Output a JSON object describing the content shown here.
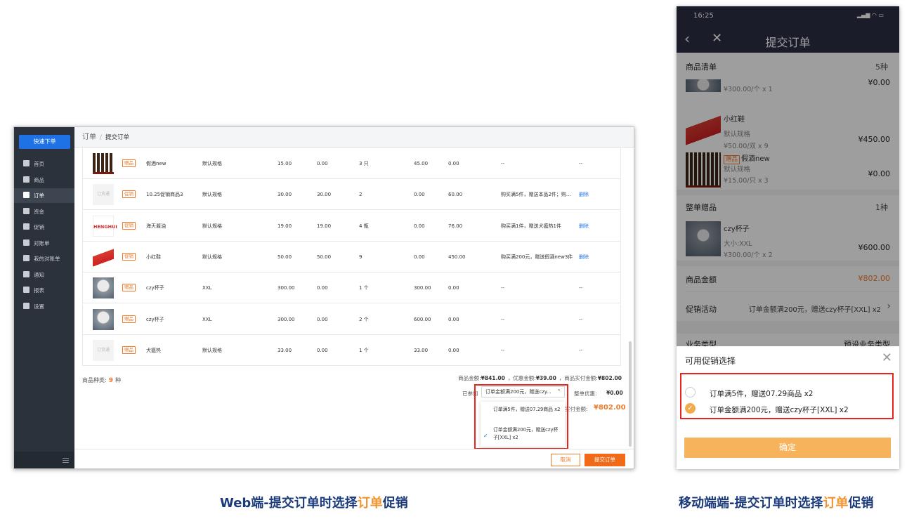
{
  "web": {
    "quick_order": "快速下单",
    "nav": [
      "首页",
      "商品",
      "订单",
      "资金",
      "促销",
      "对账单",
      "我的对账单",
      "通知",
      "报表",
      "设置"
    ],
    "nav_icons": [
      "home-icon",
      "goods-icon",
      "order-icon",
      "funds-icon",
      "promotion-icon",
      "statement-icon",
      "my-statement-icon",
      "bell-icon",
      "report-icon",
      "gear-icon"
    ],
    "active_nav": 2,
    "breadcrumb": {
      "parent": "订单",
      "current": "提交订单"
    },
    "rows": [
      {
        "img": "wine",
        "tag": "赠品",
        "name": "假酒new",
        "spec": "默认规格",
        "price": "15.00",
        "price2": "0.00",
        "qty": "3 只",
        "amount": "45.00",
        "paid": "0.00",
        "promo": "--",
        "action": "--"
      },
      {
        "img": "placeholder",
        "tag": "促销",
        "name": "10.25促销商品3",
        "spec": "默认规格",
        "price": "30.00",
        "price2": "30.00",
        "qty": "2",
        "amount": "0.00",
        "paid": "60.00",
        "promo": "购买满5件，赠送本品2件；购...",
        "action": "删除"
      },
      {
        "img": "brand",
        "tag": "促销",
        "name": "海天酱油",
        "spec": "默认规格",
        "price": "19.00",
        "price2": "19.00",
        "qty": "4 瓶",
        "amount": "0.00",
        "paid": "76.00",
        "promo": "购买满1件，赠送犬瘟热1件",
        "action": "删除"
      },
      {
        "img": "shoe",
        "tag": "促销",
        "name": "小红鞋",
        "spec": "默认规格",
        "price": "50.00",
        "price2": "50.00",
        "qty": "9",
        "amount": "0.00",
        "paid": "450.00",
        "promo": "购买满200元，赠送假酒new3件",
        "action": "删除"
      },
      {
        "img": "seal",
        "tag": "赠品",
        "name": "czy杯子",
        "spec": "XXL",
        "price": "300.00",
        "price2": "0.00",
        "qty": "1 个",
        "amount": "300.00",
        "paid": "0.00",
        "promo": "--",
        "action": "--"
      },
      {
        "img": "seal",
        "tag": "赠品",
        "name": "czy杯子",
        "spec": "XXL",
        "price": "300.00",
        "price2": "0.00",
        "qty": "2 个",
        "amount": "600.00",
        "paid": "0.00",
        "promo": "--",
        "action": "--"
      },
      {
        "img": "placeholder",
        "tag": "赠品",
        "name": "犬瘟热",
        "spec": "默认规格",
        "price": "33.00",
        "price2": "0.00",
        "qty": "1 个",
        "amount": "33.00",
        "paid": "0.00",
        "promo": "--",
        "action": "--"
      }
    ],
    "placeholder_img_text": "订货通",
    "brand_img_text": "HENGHUI",
    "summary": {
      "kinds_label": "商品种类:",
      "kinds_value": "9",
      "kinds_unit": "种",
      "goods_amount_label": "商品金额:",
      "goods_amount": "¥841.00",
      "discount_label": "，优惠金额:",
      "discount": "¥39.00",
      "paid_label": "，商品实付金额:",
      "paid": "¥802.00",
      "joined_label": "已参加",
      "selected_promo": "订单金额满200元，赠送czy...",
      "order_discount_label": "整单优惠:",
      "order_discount": "¥0.00",
      "total_label": "实付金额:",
      "total": "¥802.00"
    },
    "dropdown": [
      "订单满5件，赠送07.29商品 x2",
      "订单金额满200元，赠送czy杯子[XXL] x2"
    ],
    "dropdown_selected": 1,
    "cancel": "取消",
    "submit": "提交订单"
  },
  "mobile": {
    "time": "16:25",
    "status_icons": "signal wifi 67",
    "title": "提交订单",
    "goods_list_label": "商品清单",
    "goods_list_count": "5种",
    "item1_sub": "¥300.00/个 x 1",
    "item1_price": "¥0.00",
    "item2_name": "小红鞋",
    "item2_spec": "默认规格",
    "item2_sub": "¥50.00/双 x 9",
    "item2_price": "¥450.00",
    "item3_tag": "赠品",
    "item3_name": "假酒new",
    "item3_spec": "默认规格",
    "item3_sub": "¥15.00/只 x 3",
    "item3_price": "¥0.00",
    "gift_label": "整单赠品",
    "gift_count": "1种",
    "gift_name": "czy杯子",
    "gift_spec": "大小:XXL",
    "gift_sub": "¥300.00/个 x 2",
    "gift_price": "¥600.00",
    "amount_label": "商品金额",
    "amount_value": "¥802.00",
    "promo_label": "促销活动",
    "promo_value": "订单金额满200元，赠送czy杯子[XXL] x2",
    "biz_label": "业务类型",
    "biz_value": "预设业务类型",
    "sheet_title": "可用促销选择",
    "options": [
      "订单满5件，赠送07.29商品 x2",
      "订单金额满200元，赠送czy杯子[XXL] x2"
    ],
    "selected": 1,
    "confirm": "确定"
  },
  "captions": {
    "web_pre": "Web端-提交订单时选择",
    "web_hl": "订单",
    "web_post": "促销",
    "mobile_pre": "移动端端-提交订单时选择",
    "mobile_hl": "订单",
    "mobile_post": "促销"
  },
  "colors": {
    "accent": "#f07a2a",
    "primary": "#1f72e6",
    "sidebar": "#2c323b",
    "highlight_box": "#e8251c",
    "caption": "#1a3a7a"
  }
}
